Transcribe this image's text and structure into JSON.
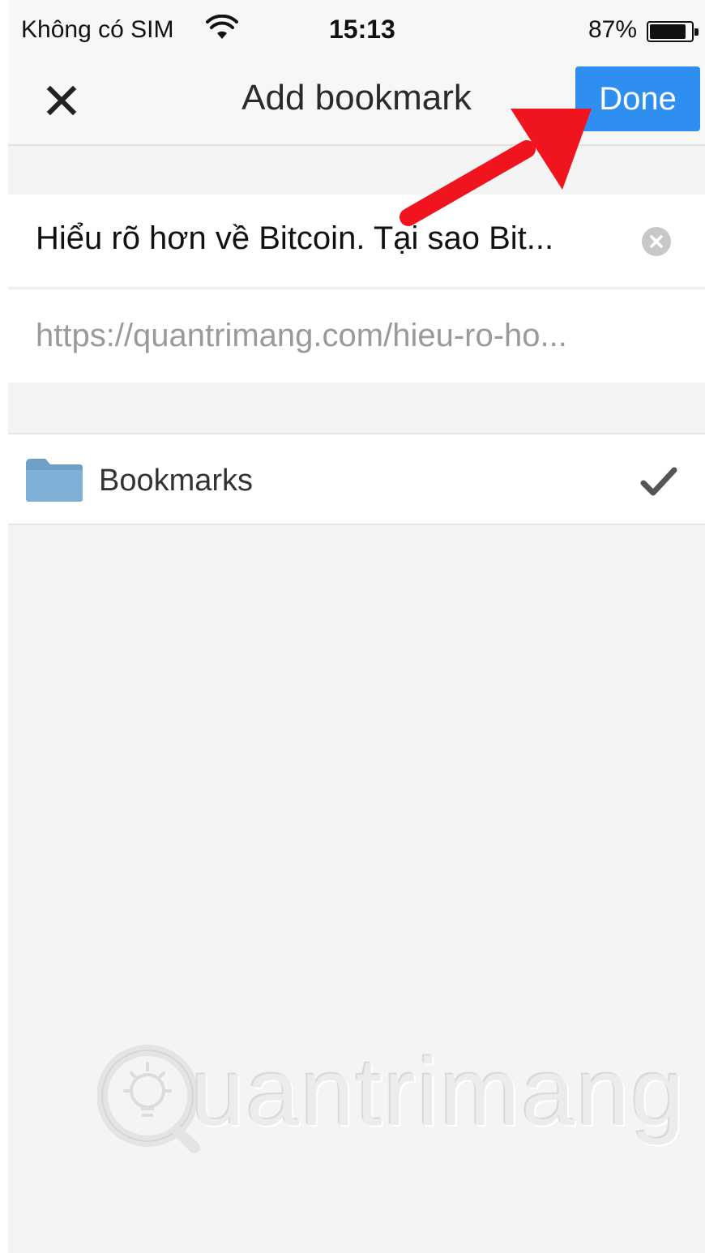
{
  "status_bar": {
    "carrier": "Không có SIM",
    "time": "15:13",
    "battery_percent": "87%",
    "battery_level": 0.87
  },
  "nav": {
    "title": "Add bookmark",
    "done_label": "Done",
    "close_icon": "close-icon",
    "done_color": "#2f8ff0"
  },
  "form": {
    "title_value": "Hiểu rõ hơn về Bitcoin. Tại sao Bit...",
    "url_value": "https://quantrimang.com/hieu-ro-ho..."
  },
  "folder": {
    "label": "Bookmarks",
    "selected": true,
    "icon": "folder-icon"
  },
  "annotation": {
    "arrow_color": "#f0141e"
  },
  "watermark": {
    "text": "uantrimang"
  }
}
